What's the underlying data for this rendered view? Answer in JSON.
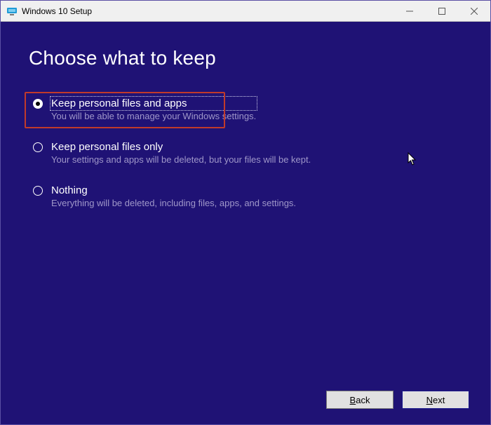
{
  "window": {
    "title": "Windows 10 Setup"
  },
  "page": {
    "heading": "Choose what to keep"
  },
  "options": [
    {
      "title": "Keep personal files and apps",
      "subtitle": "You will be able to manage your Windows settings.",
      "checked": true,
      "highlighted": true
    },
    {
      "title": "Keep personal files only",
      "subtitle": "Your settings and apps will be deleted, but your files will be kept.",
      "checked": false,
      "highlighted": false
    },
    {
      "title": "Nothing",
      "subtitle": "Everything will be deleted, including files, apps, and settings.",
      "checked": false,
      "highlighted": false
    }
  ],
  "footer": {
    "back": "Back",
    "next": "Next"
  }
}
